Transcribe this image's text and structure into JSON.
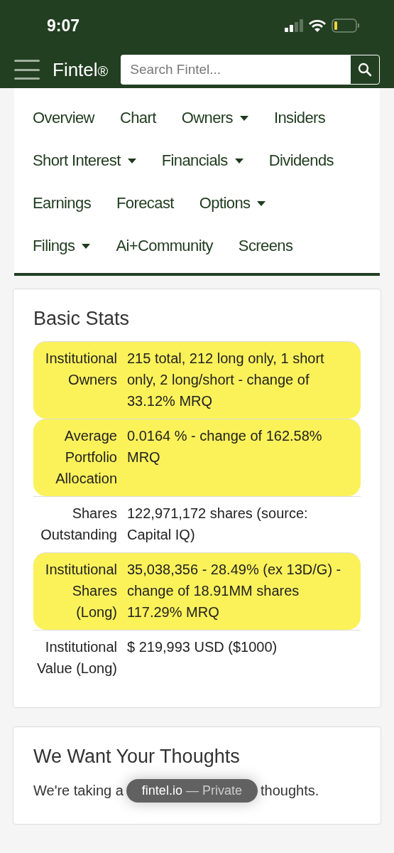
{
  "status_bar": {
    "time": "9:07"
  },
  "header": {
    "brand": "Fintel",
    "brand_mark": "®",
    "search": {
      "placeholder": "Search Fintel..."
    }
  },
  "nav_rows": [
    [
      {
        "label": "Overview",
        "has_menu": false
      },
      {
        "label": "Chart",
        "has_menu": false
      },
      {
        "label": "Owners",
        "has_menu": true
      },
      {
        "label": "Insiders",
        "has_menu": false
      }
    ],
    [
      {
        "label": "Short Interest",
        "has_menu": true
      },
      {
        "label": "Financials",
        "has_menu": true
      },
      {
        "label": "Dividends",
        "has_menu": false
      }
    ],
    [
      {
        "label": "Earnings",
        "has_menu": false
      },
      {
        "label": "Forecast",
        "has_menu": false
      },
      {
        "label": "Options",
        "has_menu": true
      }
    ],
    [
      {
        "label": "Filings",
        "has_menu": true
      },
      {
        "label": "Ai+Community",
        "has_menu": false
      },
      {
        "label": "Screens",
        "has_menu": false
      }
    ]
  ],
  "basic_stats": {
    "title": "Basic Stats",
    "rows": [
      {
        "label": "Institutional Owners",
        "value": "215 total, 212 long only, 1 short only, 2 long/short - change of 33.12% MRQ",
        "highlighted": true
      },
      {
        "label": "Average Portfolio Allocation",
        "value": "0.0164 % - change of 162.58% MRQ",
        "highlighted": true
      },
      {
        "label": "Shares Outstanding",
        "value": "122,971,172 shares (source: Capital IQ)",
        "highlighted": false
      },
      {
        "label": "Institutional Shares (Long)",
        "value": "35,038,356 - 28.49% (ex 13D/G) - change of 18.91MM shares 117.29% MRQ",
        "highlighted": true
      },
      {
        "label": "Institutional Value (Long)",
        "value": "$ 219,993 USD ($1000)",
        "highlighted": false
      }
    ]
  },
  "thoughts": {
    "title": "We Want Your Thoughts",
    "text_before": "We're taking a",
    "text_after": "thoughts."
  },
  "toast": {
    "site": "fintel.io",
    "mode": "— Private"
  }
}
